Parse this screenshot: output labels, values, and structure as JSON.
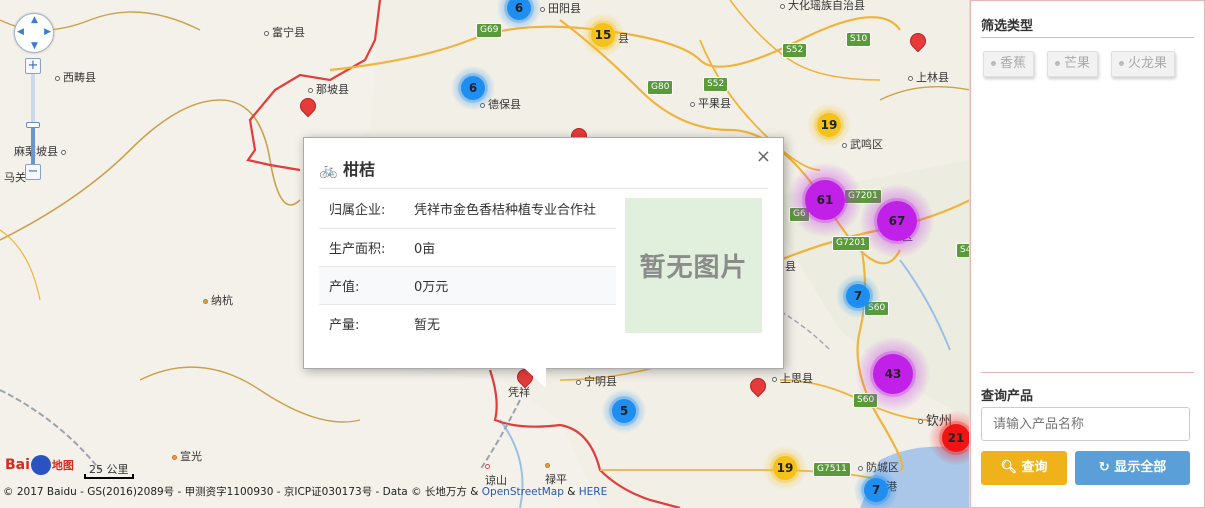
{
  "map": {
    "places": [
      {
        "name": "富宁县",
        "type": "county"
      },
      {
        "name": "西畴县",
        "type": "county"
      },
      {
        "name": "那坡县",
        "type": "county"
      },
      {
        "name": "麻栗坡县",
        "type": "county"
      },
      {
        "name": "马关",
        "type": "county"
      },
      {
        "name": "德保县",
        "type": "county"
      },
      {
        "name": "平果县",
        "type": "county"
      },
      {
        "name": "田阳县",
        "type": "county"
      },
      {
        "name": "武鸣区",
        "type": "county"
      },
      {
        "name": "上林县",
        "type": "county"
      },
      {
        "name": "大化瑶族自治县",
        "type": "county"
      },
      {
        "name": "纳杭",
        "type": "town"
      },
      {
        "name": "宁明县",
        "type": "county"
      },
      {
        "name": "上思县",
        "type": "county"
      },
      {
        "name": "谅山",
        "type": "city"
      },
      {
        "name": "禄平",
        "type": "town"
      },
      {
        "name": "宣光",
        "type": "town"
      },
      {
        "name": "防城区",
        "type": "county"
      },
      {
        "name": "钦州",
        "type": "city"
      },
      {
        "name": "凭祥",
        "type": "city"
      },
      {
        "name": "县",
        "type": "county"
      },
      {
        "name": "区",
        "type": "county"
      },
      {
        "name": "县",
        "type": "county"
      },
      {
        "name": "城港",
        "type": "county"
      }
    ],
    "highways": [
      "G69",
      "S52",
      "S10",
      "S52",
      "G80",
      "G7201",
      "G7201",
      "S60",
      "G7511",
      "S60",
      "G6",
      "S4"
    ],
    "clusters": [
      {
        "count": 6,
        "color": "blue"
      },
      {
        "count": 15,
        "color": "yellow"
      },
      {
        "count": 6,
        "color": "blue"
      },
      {
        "count": 19,
        "color": "yellow"
      },
      {
        "count": 61,
        "color": "purple"
      },
      {
        "count": 67,
        "color": "purple"
      },
      {
        "count": 7,
        "color": "blue"
      },
      {
        "count": 43,
        "color": "purple"
      },
      {
        "count": 5,
        "color": "blue"
      },
      {
        "count": 19,
        "color": "yellow"
      },
      {
        "count": 21,
        "color": "red"
      },
      {
        "count": 7,
        "color": "blue"
      }
    ],
    "scale_label": "25 公里",
    "logo_text": "Bai",
    "logo_sub": "地图",
    "copyright_prefix": "© 2017 Baidu - GS(2016)2089号 - 甲测资字1100930 - 京ICP证030173号 - Data © 长地万方 & ",
    "copyright_link1": "OpenStreetMap",
    "copyright_amp": " & ",
    "copyright_link2": "HERE",
    "colors": {
      "blue": "#1e8ef0",
      "yellow": "#f5c21a",
      "purple": "#c020e8",
      "red": "#f01414"
    }
  },
  "popup": {
    "title": "柑桔",
    "close": "×",
    "rows": [
      {
        "key": "归属企业:",
        "value": "凭祥市金色香桔种植专业合作社"
      },
      {
        "key": "生产面积:",
        "value": "0亩"
      },
      {
        "key": "产值:",
        "value": "0万元"
      },
      {
        "key": "产量:",
        "value": "暂无"
      }
    ],
    "image_text": "暂无图片"
  },
  "sidebar": {
    "filter_title": "筛选类型",
    "filters": [
      "香蕉",
      "芒果",
      "火龙果"
    ],
    "query_title": "查询产品",
    "search_placeholder": "请输入产品名称",
    "query_button": "查询",
    "show_all_button": "显示全部"
  }
}
